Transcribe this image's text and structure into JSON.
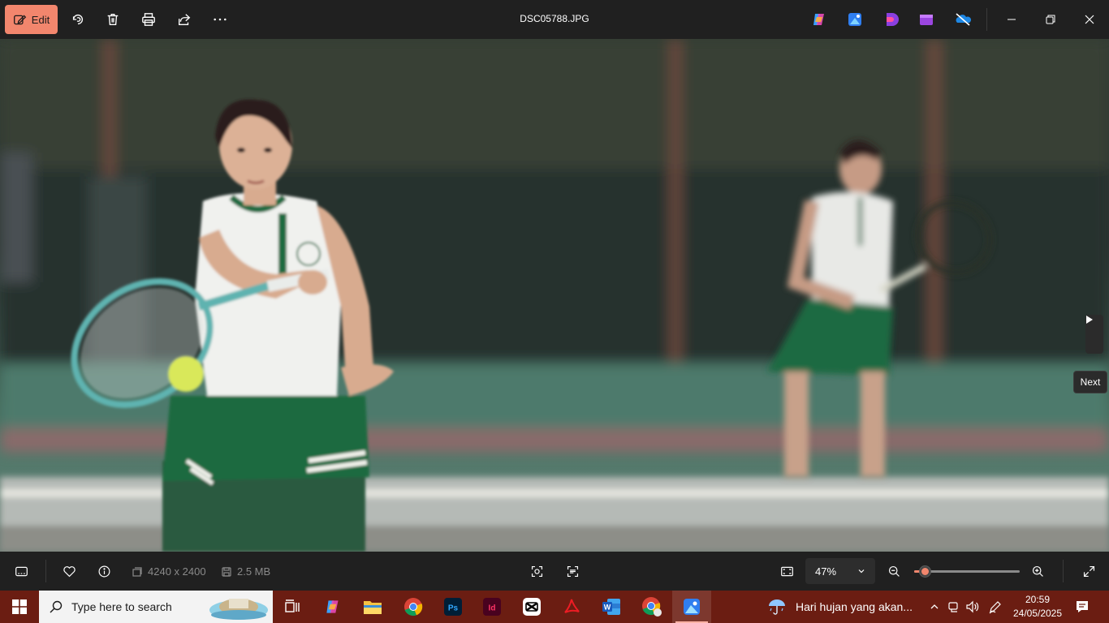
{
  "topbar": {
    "edit_label": "Edit",
    "title": "DSC05788.JPG",
    "icons": [
      "edit-icon",
      "rotate-icon",
      "delete-icon",
      "print-icon",
      "share-icon",
      "more-icon"
    ],
    "app_icons": [
      "copilot-icon",
      "photos-designer-icon",
      "clipchamp-icon",
      "video-editor-icon",
      "onedrive-icon"
    ],
    "window_controls": [
      "minimize-icon",
      "restore-icon",
      "close-icon"
    ]
  },
  "viewer": {
    "next_tooltip": "Next"
  },
  "bottombar": {
    "dimensions": "4240 x 2400",
    "file_size": "2.5 MB",
    "zoom_value": "47%",
    "zoom_fraction": 0.1
  },
  "taskbar": {
    "search_placeholder": "Type here to search",
    "weather_text": "Hari hujan yang akan...",
    "time": "20:59",
    "date": "24/05/2025",
    "apps": [
      "task-view-icon",
      "copilot-icon",
      "file-explorer-icon",
      "chrome-icon",
      "photoshop-icon",
      "indesign-icon",
      "capcut-icon",
      "acrobat-icon",
      "word-icon",
      "chrome-profile-icon",
      "photos-icon"
    ],
    "colors": {
      "taskbar": "#6b1d12",
      "accent": "#f2866d"
    }
  }
}
